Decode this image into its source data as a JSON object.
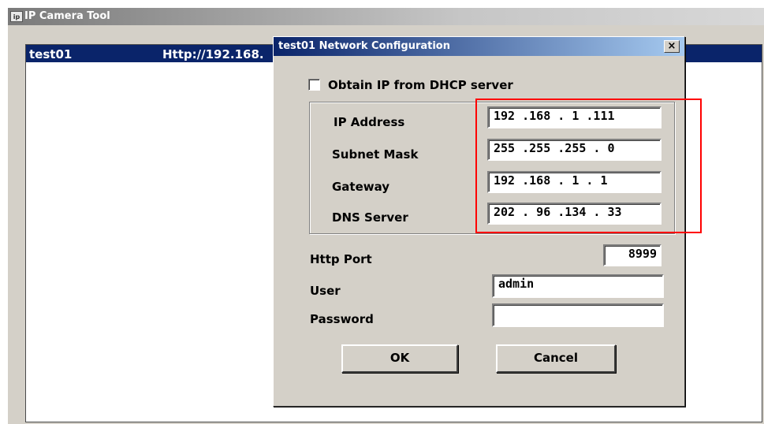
{
  "app": {
    "title": "IP Camera Tool",
    "icon": "camera-tool-icon"
  },
  "list": {
    "rows": [
      {
        "name": "test01",
        "url": "Http://192.168."
      }
    ]
  },
  "dialog": {
    "title": "test01 Network Configuration",
    "close_label": "×",
    "dhcp": {
      "label": "Obtain IP from DHCP server",
      "checked": false
    },
    "ip_address": {
      "label": "IP Address",
      "value": "192 .168 .  1  .111"
    },
    "subnet_mask": {
      "label": "Subnet Mask",
      "value": "255 .255 .255 .  0"
    },
    "gateway": {
      "label": "Gateway",
      "value": "192 .168 .  1  .  1"
    },
    "dns_server": {
      "label": "DNS Server",
      "value": "202 .  96 .134 .  33"
    },
    "http_port": {
      "label": "Http Port",
      "value": "8999"
    },
    "user": {
      "label": "User",
      "value": "admin"
    },
    "password": {
      "label": "Password",
      "value": ""
    },
    "ok_label": "OK",
    "cancel_label": "Cancel"
  },
  "colors": {
    "selection": "#0a246a",
    "annotation": "#ff0000",
    "face": "#d4d0c8"
  }
}
